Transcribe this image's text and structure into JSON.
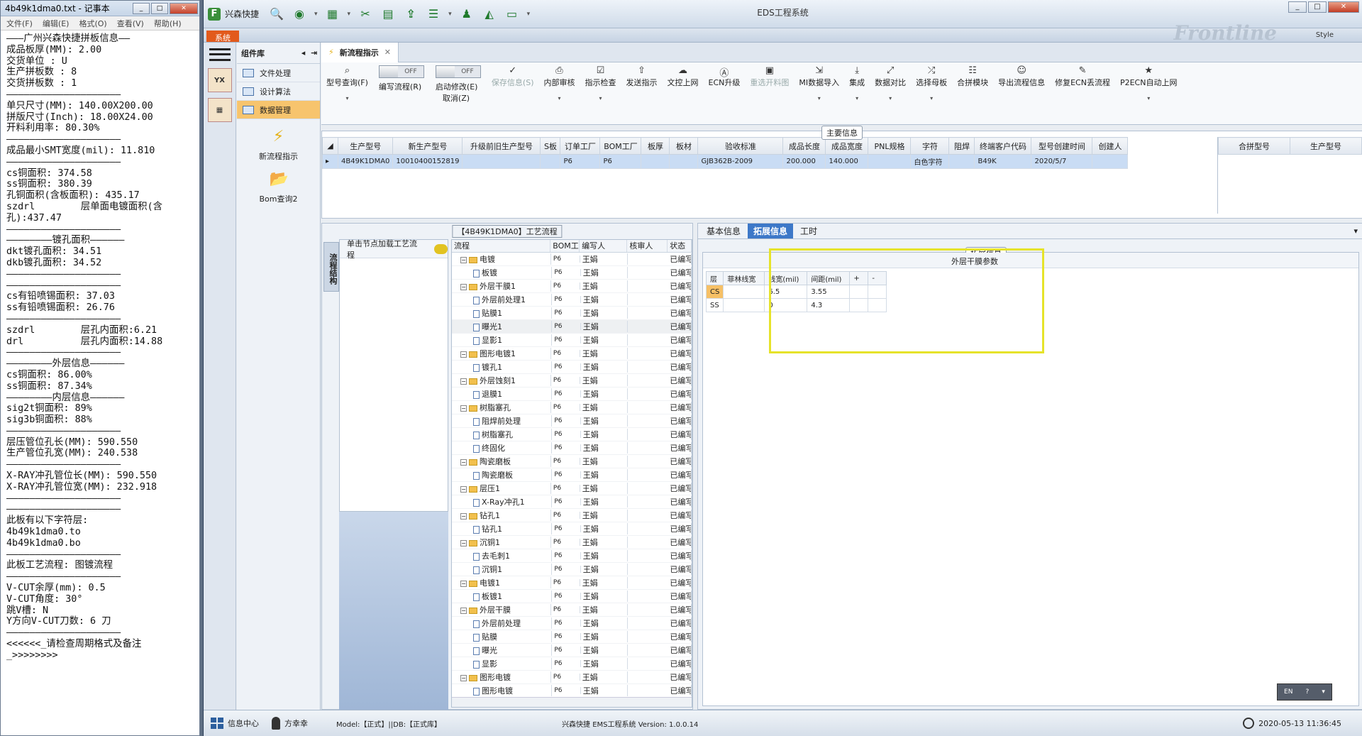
{
  "notepad": {
    "title": "4b49k1dma0.txt - 记事本",
    "menu": [
      "文件(F)",
      "编辑(E)",
      "格式(O)",
      "查看(V)",
      "帮助(H)"
    ],
    "content": "―――广州兴森快捷拼板信息――\n成品板厚(MM): 2.00\n交货单位 : U\n生产拼板数 : 8\n交货拼板数 : 1\n――――――――――――――――――――\n单只尺寸(MM): 140.00X200.00\n拼版尺寸(Inch): 18.00X24.00\n开料利用率: 80.30%\n――――――――――――――――――――\n成品最小SMT宽度(mil): 11.810\n――――――――――――――――――――\ncs铜面积: 374.58\nss铜面积: 380.39\n孔铜面积(含板面积): 435.17\nszdrl        层单面电镀面积(含\n孔):437.47\n――――――――――――――――――――\n――――――――镀孔面积――――――\ndkt镀孔面积: 34.51\ndkb镀孔面积: 34.52\n――――――――――――――――――――\n――――――――――――――――――――\ncs有铅喷锡面积: 37.03\nss有铅喷锡面积: 26.76\n――――――――――――――――――――\nszdrl        层孔内面积:6.21\ndrl          层孔内面积:14.88\n――――――――――――――――――――\n――――――――外层信息――――――\ncs铜面积: 86.00%\nss铜面积: 87.34%\n――――――――内层信息――――――\nsig2t铜面积: 89%\nsig3b铜面积: 88%\n――――――――――――――――――――\n层压管位孔长(MM): 590.550\n生产管位孔宽(MM): 240.538\n――――――――――――――――――――\nX-RAY冲孔管位长(MM): 590.550\nX-RAY冲孔管位宽(MM): 232.918\n――――――――――――――――――――\n――――――――――――――――――――\n此板有以下字符层:\n4b49k1dma0.to\n4b49k1dma0.bo\n――――――――――――――――――――\n此板工艺流程: 图镀流程\n――――――――――――――――――――\nV-CUT余厚(mm): 0.5\nV-CUT角度: 30°\n跳V槽: N\nY方向V-CUT刀数: 6 刀\n――――――――――――――――――――\n<<<<<<_请检查周期格式及备注\n_>>>>>>>>"
  },
  "app": {
    "quick_title": "兴森快捷",
    "window_title": "EDS工程系统",
    "system_tab": "系统",
    "brand": "Frontline",
    "style_label": "Style",
    "component_lib": "组件库",
    "components": [
      "文件处理",
      "设计算法",
      "数据管理"
    ],
    "big_items": [
      "新流程指示",
      "Bom查询2"
    ],
    "doc_tab": "新流程指示",
    "toolbar": {
      "model_query": "型号查询(F)",
      "toggle1_label": "编写流程(R)",
      "toggle2_label": "启动修改(E)",
      "toggle2_sub": "取消(Z)",
      "toggle_off": "OFF",
      "buttons": [
        "保存信息(S)",
        "内部审核",
        "指示检查",
        "发送指示",
        "文控上网",
        "ECN升级",
        "重选开料图",
        "MI数据导入",
        "集成",
        "数据对比",
        "选择母板",
        "合拼模块",
        "导出流程信息",
        "修复ECN丢流程",
        "P2ECN自动上网"
      ]
    },
    "main_info": {
      "label": "主要信息",
      "columns": [
        "生产型号",
        "新生产型号",
        "升级前旧生产型号",
        "S板",
        "订单工厂",
        "BOM工厂",
        "板厚",
        "板材",
        "验收标准",
        "成品长度",
        "成品宽度",
        "PNL规格",
        "字符",
        "阻焊",
        "终端客户代码",
        "型号创建时间",
        "创建人"
      ],
      "row": [
        "4B49K1DMA0",
        "10010400152819",
        "",
        "",
        "P6",
        "P6",
        "",
        "",
        "GJB362B-2009",
        "200.000",
        "140.000",
        "",
        "白色字符",
        "",
        "B49K",
        "2020/5/7",
        ""
      ],
      "combo_cols": [
        "合拼型号",
        "生产型号"
      ]
    },
    "process": {
      "title": "【4B49K1DMA0】工艺流程",
      "vertical_tab": "流程结构",
      "hint": "单击节点加载工艺流程",
      "cols": [
        "流程",
        "BOM工厂",
        "编写人",
        "核审人",
        "状态"
      ],
      "rows": [
        {
          "name": "电镀",
          "lvl": 1,
          "type": "folder"
        },
        {
          "name": "板镀",
          "lvl": 2,
          "type": "doc"
        },
        {
          "name": "外层干膜1",
          "lvl": 1,
          "type": "folder"
        },
        {
          "name": "外层前处理1",
          "lvl": 2,
          "type": "doc"
        },
        {
          "name": "贴膜1",
          "lvl": 2,
          "type": "doc"
        },
        {
          "name": "曝光1",
          "lvl": 2,
          "type": "doc"
        },
        {
          "name": "显影1",
          "lvl": 2,
          "type": "doc"
        },
        {
          "name": "图形电镀1",
          "lvl": 1,
          "type": "folder"
        },
        {
          "name": "镀孔1",
          "lvl": 2,
          "type": "doc"
        },
        {
          "name": "外层蚀刻1",
          "lvl": 1,
          "type": "folder"
        },
        {
          "name": "退膜1",
          "lvl": 2,
          "type": "doc"
        },
        {
          "name": "树脂塞孔",
          "lvl": 1,
          "type": "folder"
        },
        {
          "name": "阻焊前处理",
          "lvl": 2,
          "type": "doc"
        },
        {
          "name": "树脂塞孔",
          "lvl": 2,
          "type": "doc"
        },
        {
          "name": "终固化",
          "lvl": 2,
          "type": "doc"
        },
        {
          "name": "陶瓷磨板",
          "lvl": 1,
          "type": "folder"
        },
        {
          "name": "陶瓷磨板",
          "lvl": 2,
          "type": "doc"
        },
        {
          "name": "层压1",
          "lvl": 1,
          "type": "folder"
        },
        {
          "name": "X-Ray冲孔1",
          "lvl": 2,
          "type": "doc"
        },
        {
          "name": "钻孔1",
          "lvl": 1,
          "type": "folder"
        },
        {
          "name": "钻孔1",
          "lvl": 2,
          "type": "doc"
        },
        {
          "name": "沉铜1",
          "lvl": 1,
          "type": "folder"
        },
        {
          "name": "去毛刺1",
          "lvl": 2,
          "type": "doc"
        },
        {
          "name": "沉铜1",
          "lvl": 2,
          "type": "doc"
        },
        {
          "name": "电镀1",
          "lvl": 1,
          "type": "folder"
        },
        {
          "name": "板镀1",
          "lvl": 2,
          "type": "doc"
        },
        {
          "name": "外层干膜",
          "lvl": 1,
          "type": "folder"
        },
        {
          "name": "外层前处理",
          "lvl": 2,
          "type": "doc"
        },
        {
          "name": "贴膜",
          "lvl": 2,
          "type": "doc"
        },
        {
          "name": "曝光",
          "lvl": 2,
          "type": "doc"
        },
        {
          "name": "显影",
          "lvl": 2,
          "type": "doc"
        },
        {
          "name": "图形电镀",
          "lvl": 1,
          "type": "folder"
        },
        {
          "name": "图形电镀",
          "lvl": 2,
          "type": "doc"
        }
      ],
      "factory": "P6",
      "author": "王娟",
      "status": "已编写"
    },
    "right": {
      "tabs": [
        "基本信息",
        "拓展信息",
        "工时"
      ],
      "ext_label": "拓展信息",
      "ext_title": "外层干膜参数",
      "cols": [
        "层",
        "菲林线宽",
        "线宽(mil)",
        "间距(mil)",
        "+",
        "-"
      ],
      "rows": [
        [
          "CS",
          "",
          "6.5",
          "3.55",
          "",
          ""
        ],
        [
          "SS",
          "",
          "0",
          "4.3",
          "",
          ""
        ]
      ]
    },
    "status": {
      "info_center": "信息中心",
      "user": "方幸幸",
      "model": "Model:【正式】||DB:【正式库】",
      "version": "兴森快捷  EMS工程系统  Version: 1.0.0.14",
      "datetime": "2020-05-13 11:36:45"
    },
    "lang": "EN"
  }
}
